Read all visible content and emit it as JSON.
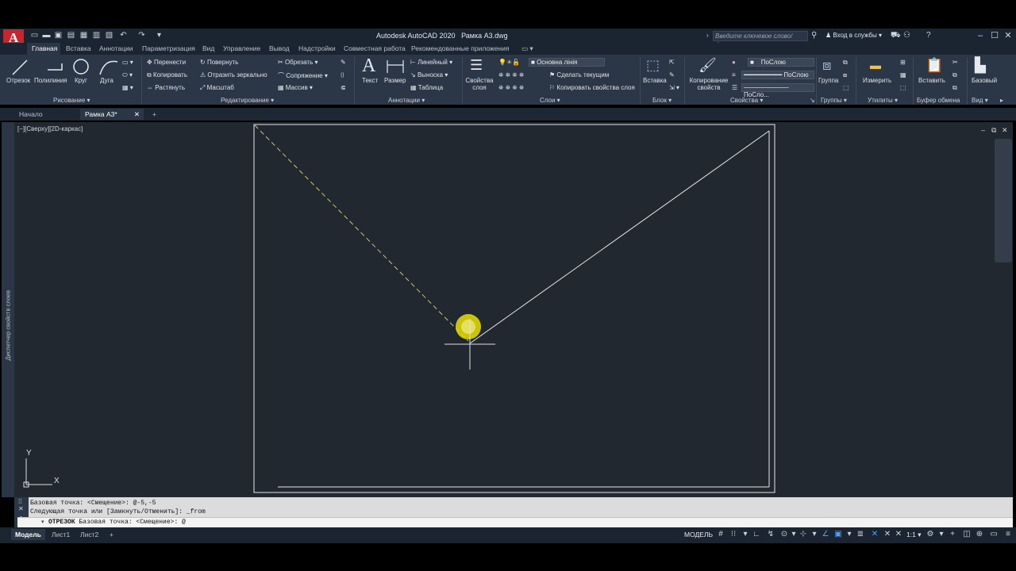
{
  "title": {
    "app": "Autodesk AutoCAD 2020",
    "file": "Рамка А3.dwg",
    "search_placeholder": "Введите ключевое слово/фразу",
    "signin": "Вход в службы",
    "app_logo": "A"
  },
  "ribbon_tabs": [
    "Главная",
    "Вставка",
    "Аннотации",
    "Параметризация",
    "Вид",
    "Управление",
    "Вывод",
    "Надстройки",
    "Совместная работа",
    "Рекомендованные приложения"
  ],
  "panels": {
    "draw": {
      "title": "Рисование",
      "tools": [
        "Отрезок",
        "Полилиния",
        "Круг",
        "Дуга"
      ]
    },
    "modify": {
      "title": "Редактирование",
      "items": [
        "Перенести",
        "Повернуть",
        "Обрезать",
        "Копировать",
        "Отразить зеркально",
        "Сопряжение",
        "Растянуть",
        "Масштаб",
        "Массив"
      ]
    },
    "annotation": {
      "title": "Аннотации",
      "big": [
        "Текст",
        "Размер"
      ],
      "items": [
        "Линейный",
        "Выноска",
        "Таблица"
      ]
    },
    "layers": {
      "title": "Слои",
      "big": "Свойства слоя",
      "current_layer": "Основна лінія",
      "items": [
        "Сделать текущим",
        "Копировать свойства слоя"
      ]
    },
    "block": {
      "title": "Блок",
      "big": "Вставка"
    },
    "properties": {
      "title": "Свойства",
      "big": "Копирование свойств",
      "combos": [
        "ПоСлою",
        "ПоСлою",
        "ПоСло..."
      ]
    },
    "groups": {
      "title": "Группы",
      "big": "Группа"
    },
    "utilities": {
      "title": "Утилиты",
      "big": "Измерить"
    },
    "clipboard": {
      "title": "Буфер обмена",
      "big": "Вставить"
    },
    "view": {
      "title": "Вид",
      "big": "Базовый"
    }
  },
  "doc_tabs": [
    "Начало",
    "Рамка А3*"
  ],
  "viewport_label": "[−][Сверху][2D-каркас]",
  "side_palette_label": "Диспетчер свойств слоев",
  "ucs": {
    "y": "Y",
    "x": "X"
  },
  "command": {
    "history": [
      "Базовая точка: <Смещение>: @-5,-5",
      "Следующая точка или [Замкнуть/Отменить]: _from"
    ],
    "prompt_cmd": "ОТРЕЗОК",
    "prompt_text": "Базовая точка: <Смещение>: @"
  },
  "layout_tabs": [
    "Модель",
    "Лист1",
    "Лист2"
  ],
  "status": {
    "space": "МОДЕЛЬ",
    "scale": "1:1"
  },
  "colors": {
    "drawing_bg": "#212830",
    "ribbon_bg": "#2b3646",
    "cursor_highlight": "#e8e000",
    "rubberband": "#c9c96a"
  }
}
